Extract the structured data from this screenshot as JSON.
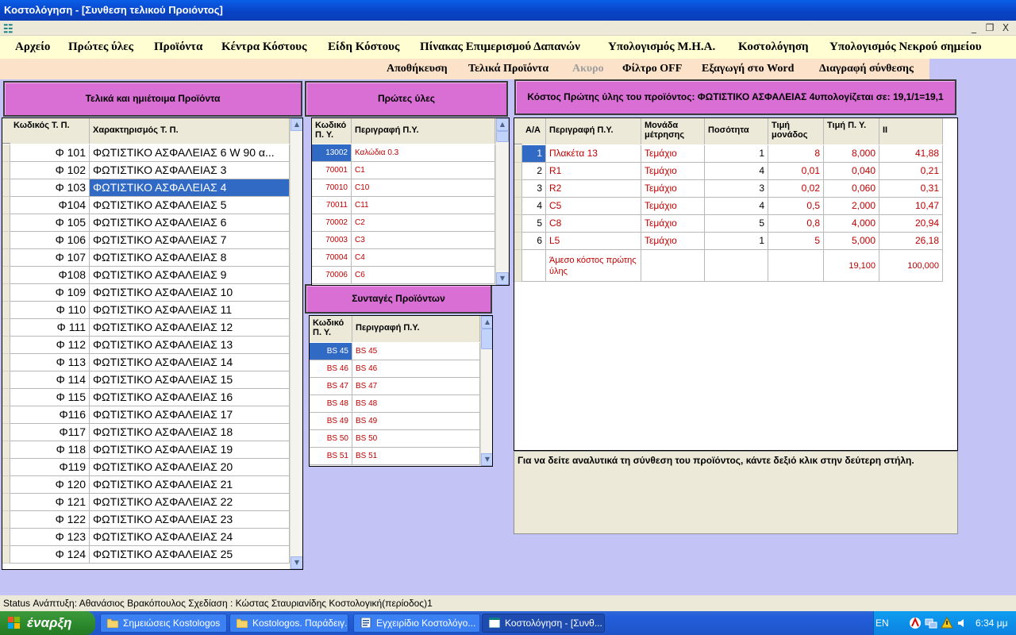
{
  "window": {
    "title": "Κοστολόγηση - [Συνθεση τελικού Προιόντος]"
  },
  "mdi": {
    "minimize": "_",
    "restore": "❐",
    "close": "X"
  },
  "menu": [
    {
      "label": "Αρχείο"
    },
    {
      "label": "Πρώτες ύλες"
    },
    {
      "label": "Προϊόντα"
    },
    {
      "label": "Κέντρα Κόστους"
    },
    {
      "label": "Είδη Κόστους"
    },
    {
      "label": "Πίνακας Επιμερισμού Δαπανών"
    },
    {
      "label": "Υπολογισμός Μ.Η.Α."
    },
    {
      "label": "Κοστολόγηση"
    },
    {
      "label": "Υπολογισμός Νεκρού σημείου"
    }
  ],
  "toolbar": [
    {
      "label": "Αποθήκευση",
      "disabled": false
    },
    {
      "label": "Τελικά Προϊόντα",
      "disabled": false
    },
    {
      "label": "Ακυρο",
      "disabled": true
    },
    {
      "label": "Φίλτρο OFF",
      "disabled": false
    },
    {
      "label": "Εξαγωγή στο Word",
      "disabled": false
    },
    {
      "label": "Διαγραφή σύνθεσης",
      "disabled": false
    }
  ],
  "products": {
    "header": "Τελικά και ημιέτοιμα Προϊόντα",
    "columns": [
      "Κωδικός Τ. Π.",
      "Χαρακτηρισμός Τ. Π."
    ],
    "selected_index": 2,
    "rows": [
      {
        "code": "Φ 101",
        "name": "ΦΩΤΙΣΤΙΚΟ ΑΣΦΑΛΕΙΑΣ  6 W 90 α..."
      },
      {
        "code": "Φ 102",
        "name": "ΦΩΤΙΣΤΙΚΟ ΑΣΦΑΛΕΙΑΣ 3"
      },
      {
        "code": "Φ 103",
        "name": "ΦΩΤΙΣΤΙΚΟ ΑΣΦΑΛΕΙΑΣ 4"
      },
      {
        "code": "Φ104",
        "name": "ΦΩΤΙΣΤΙΚΟ ΑΣΦΑΛΕΙΑΣ 5"
      },
      {
        "code": "Φ 105",
        "name": "ΦΩΤΙΣΤΙΚΟ ΑΣΦΑΛΕΙΑΣ 6"
      },
      {
        "code": "Φ 106",
        "name": "ΦΩΤΙΣΤΙΚΟ ΑΣΦΑΛΕΙΑΣ 7"
      },
      {
        "code": "Φ 107",
        "name": "ΦΩΤΙΣΤΙΚΟ ΑΣΦΑΛΕΙΑΣ 8"
      },
      {
        "code": "Φ108",
        "name": "ΦΩΤΙΣΤΙΚΟ ΑΣΦΑΛΕΙΑΣ 9"
      },
      {
        "code": "Φ 109",
        "name": "ΦΩΤΙΣΤΙΚΟ ΑΣΦΑΛΕΙΑΣ 10"
      },
      {
        "code": "Φ 110",
        "name": "ΦΩΤΙΣΤΙΚΟ ΑΣΦΑΛΕΙΑΣ 11"
      },
      {
        "code": "Φ 111",
        "name": "ΦΩΤΙΣΤΙΚΟ ΑΣΦΑΛΕΙΑΣ 12"
      },
      {
        "code": "Φ 112",
        "name": "ΦΩΤΙΣΤΙΚΟ ΑΣΦΑΛΕΙΑΣ 13"
      },
      {
        "code": "Φ 113",
        "name": "ΦΩΤΙΣΤΙΚΟ ΑΣΦΑΛΕΙΑΣ 14"
      },
      {
        "code": "Φ 114",
        "name": "ΦΩΤΙΣΤΙΚΟ ΑΣΦΑΛΕΙΑΣ 15"
      },
      {
        "code": "Φ 115",
        "name": "ΦΩΤΙΣΤΙΚΟ ΑΣΦΑΛΕΙΑΣ 16"
      },
      {
        "code": "Φ116",
        "name": "ΦΩΤΙΣΤΙΚΟ ΑΣΦΑΛΕΙΑΣ 17"
      },
      {
        "code": "Φ117",
        "name": "ΦΩΤΙΣΤΙΚΟ ΑΣΦΑΛΕΙΑΣ 18"
      },
      {
        "code": "Φ 118",
        "name": "ΦΩΤΙΣΤΙΚΟ ΑΣΦΑΛΕΙΑΣ 19"
      },
      {
        "code": "Φ119",
        "name": "ΦΩΤΙΣΤΙΚΟ ΑΣΦΑΛΕΙΑΣ 20"
      },
      {
        "code": "Φ 120",
        "name": "ΦΩΤΙΣΤΙΚΟ ΑΣΦΑΛΕΙΑΣ 21"
      },
      {
        "code": "Φ 121",
        "name": "ΦΩΤΙΣΤΙΚΟ ΑΣΦΑΛΕΙΑΣ 22"
      },
      {
        "code": "Φ 122",
        "name": "ΦΩΤΙΣΤΙΚΟ ΑΣΦΑΛΕΙΑΣ 23"
      },
      {
        "code": "Φ 123",
        "name": "ΦΩΤΙΣΤΙΚΟ ΑΣΦΑΛΕΙΑΣ 24"
      },
      {
        "code": "Φ 124",
        "name": "ΦΩΤΙΣΤΙΚΟ ΑΣΦΑΛΕΙΑΣ 25"
      }
    ]
  },
  "raw_materials": {
    "header": "Πρώτες ύλες",
    "columns": [
      "Κωδικό Π. Υ.",
      "Περιγραφή Π.Υ."
    ],
    "selected_index": 0,
    "rows": [
      {
        "code": "13002",
        "desc": "Καλώδια 0.3"
      },
      {
        "code": "70001",
        "desc": "C1"
      },
      {
        "code": "70010",
        "desc": "C10"
      },
      {
        "code": "70011",
        "desc": "C11"
      },
      {
        "code": "70002",
        "desc": "C2"
      },
      {
        "code": "70003",
        "desc": "C3"
      },
      {
        "code": "70004",
        "desc": "C4"
      },
      {
        "code": "70006",
        "desc": "C6"
      }
    ]
  },
  "recipes": {
    "header": "Συνταγές Προϊόντων",
    "columns": [
      "Κωδικό Π. Υ.",
      "Περιγραφή Π.Υ."
    ],
    "selected_index": 0,
    "rows": [
      {
        "code": "BS 45",
        "desc": "BS 45"
      },
      {
        "code": "BS 46",
        "desc": "BS 46"
      },
      {
        "code": "BS 47",
        "desc": "BS 47"
      },
      {
        "code": "BS 48",
        "desc": "BS 48"
      },
      {
        "code": "BS 49",
        "desc": "BS 49"
      },
      {
        "code": "BS 50",
        "desc": "BS 50"
      },
      {
        "code": "BS 51",
        "desc": "BS 51"
      }
    ]
  },
  "cost": {
    "header": "Κόστος Πρώτης ύλης του προϊόντος:  ΦΩΤΙΣΤΙΚΟ ΑΣΦΑΛΕΙΑΣ 4υπολογίζεται σε: 19,1/1=19,1",
    "columns": [
      "Α/Α",
      "Περιγραφή Π.Υ.",
      "Μονάδα μέτρησης",
      "Ποσότητα",
      "Τιμή μονάδος",
      "Τιμή Π. Υ.",
      "II"
    ],
    "selected_index": 0,
    "rows": [
      {
        "aa": "1",
        "desc": "Πλακέτα 13",
        "unit": "Τεμάχιο",
        "qty": "1",
        "price": "8",
        "total": "8,000",
        "pct": "41,88"
      },
      {
        "aa": "2",
        "desc": "R1",
        "unit": "Τεμάχιο",
        "qty": "4",
        "price": "0,01",
        "total": "0,040",
        "pct": "0,21"
      },
      {
        "aa": "3",
        "desc": "R2",
        "unit": "Τεμάχιο",
        "qty": "3",
        "price": "0,02",
        "total": "0,060",
        "pct": "0,31"
      },
      {
        "aa": "4",
        "desc": "C5",
        "unit": "Τεμάχιο",
        "qty": "4",
        "price": "0,5",
        "total": "2,000",
        "pct": "10,47"
      },
      {
        "aa": "5",
        "desc": "C8",
        "unit": "Τεμάχιο",
        "qty": "5",
        "price": "0,8",
        "total": "4,000",
        "pct": "20,94"
      },
      {
        "aa": "6",
        "desc": "L5",
        "unit": "Τεμάχιο",
        "qty": "1",
        "price": "5",
        "total": "5,000",
        "pct": "26,18"
      }
    ],
    "total_row": {
      "label": "Άμεσο κόστος πρώτης ύλης",
      "total": "19,100",
      "pct": "100,000"
    }
  },
  "info": "Για να δείτε αναλυτικά τη σύνθεση του προϊόντος, κάντε δεξιό κλικ στην δεύτερη στήλη.",
  "status": "Status  Ανάπτυξη: Αθανάσιος Βρακόπουλος  Σχεδίαση : Κώστας Σταυριανίδης  Κοστολογική(περίοδος)1",
  "taskbar": {
    "start": "έναρξη",
    "items": [
      {
        "label": "Σημειώσεις Kostologos",
        "active": false
      },
      {
        "label": "Kostologos. Παράδειγ...",
        "active": false
      },
      {
        "label": "Εγχειρίδιο Κοστολόγο...",
        "active": false
      },
      {
        "label": "Κοστολόγηση - [Συνθ...",
        "active": true
      }
    ],
    "lang": "EN",
    "clock": "6:34 μμ"
  },
  "colors": {
    "header_button": "#d96fd5",
    "selection": "#316ac5",
    "data_text_red": "#c00000",
    "menubar": "#fefed2",
    "toolbar": "#fbe2c8",
    "background": "#c3c3f5"
  }
}
